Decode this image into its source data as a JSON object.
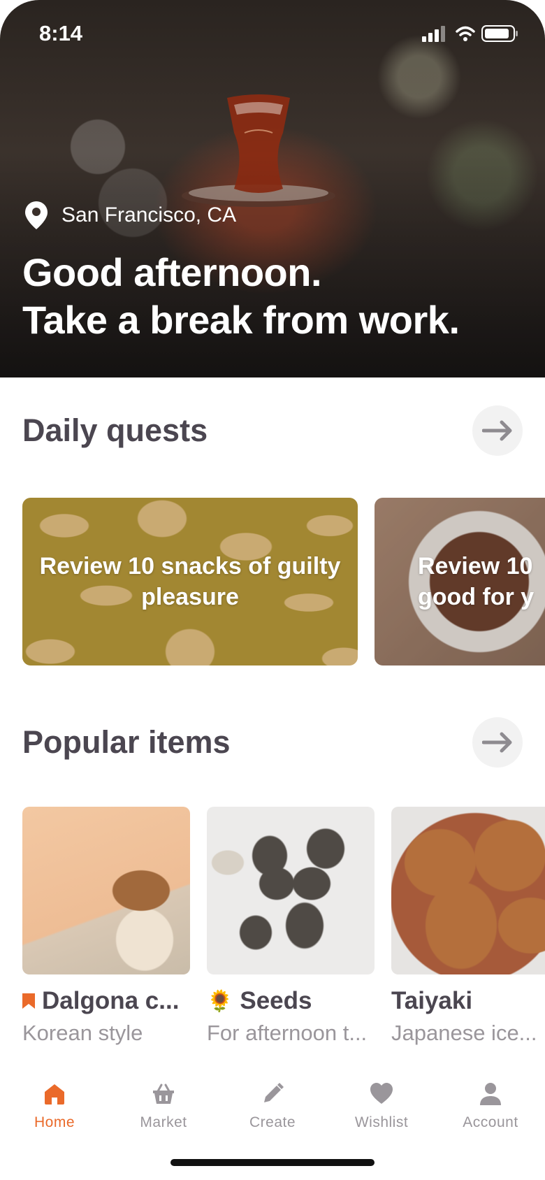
{
  "status_bar": {
    "time": "8:14",
    "icons": [
      "signal-icon",
      "wifi-icon",
      "battery-icon"
    ]
  },
  "hero": {
    "location": "San Francisco, CA",
    "greeting_line1": "Good afternoon.",
    "greeting_line2": "Take a break from work."
  },
  "daily_quests": {
    "title": "Daily quests",
    "cards": [
      {
        "text": "Review 10 snacks of guilty pleasure"
      },
      {
        "text": "Review 10 good for y"
      }
    ]
  },
  "popular_items": {
    "title": "Popular items",
    "items": [
      {
        "name": "Dalgona c...",
        "subtitle": "Korean style",
        "icon": "bookmark-icon"
      },
      {
        "name": "Seeds",
        "subtitle": "For afternoon t...",
        "icon": "sunflower-emoji",
        "emoji": "🌻"
      },
      {
        "name": "Taiyaki",
        "subtitle": "Japanese ice..."
      }
    ]
  },
  "bottom_nav": {
    "items": [
      {
        "label": "Home",
        "icon": "home-icon",
        "active": true
      },
      {
        "label": "Market",
        "icon": "basket-icon",
        "active": false
      },
      {
        "label": "Create",
        "icon": "pencil-icon",
        "active": false
      },
      {
        "label": "Wishlist",
        "icon": "heart-icon",
        "active": false
      },
      {
        "label": "Account",
        "icon": "user-icon",
        "active": false
      }
    ]
  },
  "colors": {
    "accent": "#ea6a2a",
    "title_text": "#4b4650",
    "muted_text": "#9a969b",
    "arrow_bg": "#f2f2f2"
  }
}
